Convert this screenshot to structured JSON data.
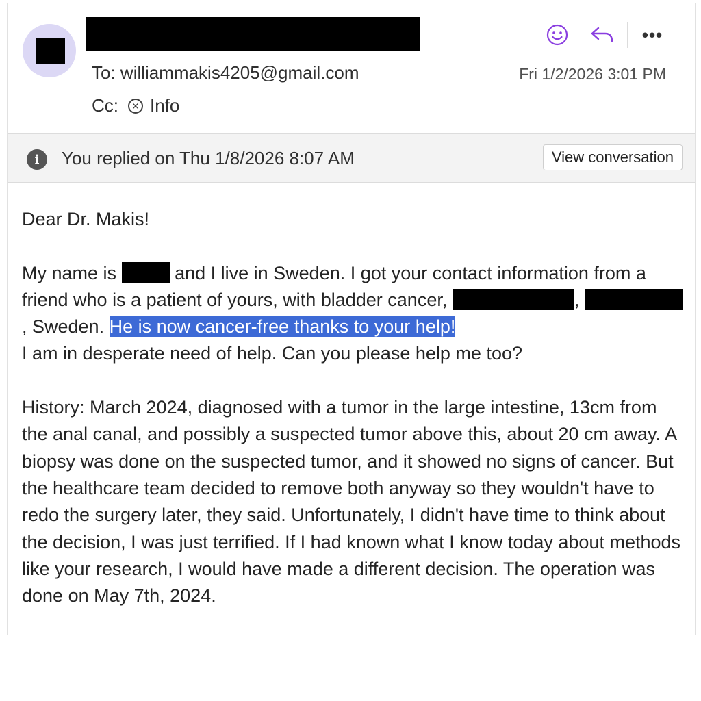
{
  "header": {
    "to_label": "To:",
    "to_address": "williammakis4205@gmail.com",
    "cc_label": "Cc:",
    "cc_recipient": "Info",
    "date": "Fri 1/2/2026 3:01 PM"
  },
  "icons": [
    "smiley-icon",
    "reply-icon",
    "more-icon",
    "info-icon",
    "remove-recipient-icon"
  ],
  "colors": {
    "accent": "#8a3ee0",
    "highlight": "#3d6ad6",
    "avatar_bg": "#dcd8f5"
  },
  "infobar": {
    "text": "You replied on Thu 1/8/2026 8:07 AM",
    "button_label": "View conversation"
  },
  "body": {
    "greeting": "Dear Dr. Makis!",
    "p2_a": "My name is",
    "p2_b": "and I live in Sweden. I got your contact information from a friend who is a patient of yours, with bladder cancer,",
    "p2_c": ",",
    "p2_d": ", Sweden.",
    "p2_highlight": "He is now cancer-free thanks to your help!",
    "p2_e": "I am in desperate need of help. Can you please help me too?",
    "history": "History: March 2024, diagnosed with a tumor in the large intestine, 13cm from the anal canal, and possibly a suspected tumor above this, about 20 cm away. A biopsy was done on the suspected tumor, and it showed no signs of cancer. But the healthcare team decided to remove both anyway so they wouldn't have to redo the surgery later, they said. Unfortunately, I didn't have time to think about the decision, I was just terrified. If I had known what I know today about methods like your research, I would have made a different decision. The operation was done on May 7th, 2024."
  }
}
